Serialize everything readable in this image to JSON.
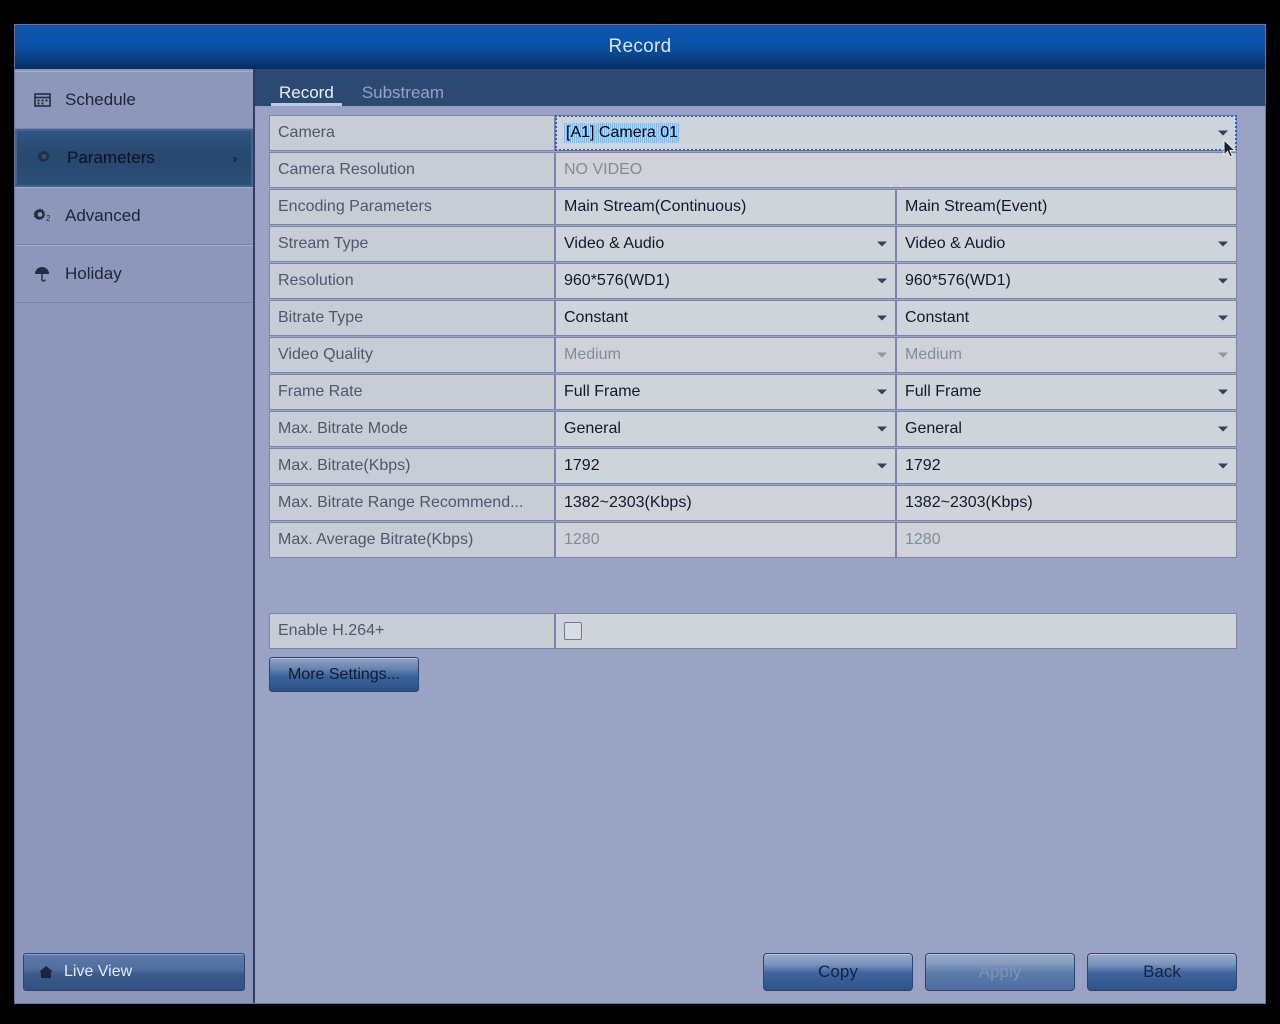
{
  "window": {
    "title": "Record"
  },
  "sidebar": {
    "items": [
      {
        "label": "Schedule",
        "icon": "calendar-icon",
        "active": false,
        "chevron": ""
      },
      {
        "label": "Parameters",
        "icon": "gear-icon",
        "active": true,
        "chevron": "›"
      },
      {
        "label": "Advanced",
        "icon": "gear-advanced-icon",
        "active": false,
        "chevron": ""
      },
      {
        "label": "Holiday",
        "icon": "umbrella-icon",
        "active": false,
        "chevron": ""
      }
    ],
    "live_view": {
      "label": "Live View",
      "icon": "home-icon"
    }
  },
  "tabs": [
    {
      "label": "Record",
      "active": true
    },
    {
      "label": "Substream",
      "active": false
    }
  ],
  "form": {
    "camera": {
      "label": "Camera",
      "value": "[A1] Camera 01",
      "selected": true
    },
    "camera_resolution": {
      "label": "Camera Resolution",
      "value": "NO VIDEO"
    },
    "columns": [
      "Main Stream(Continuous)",
      "Main Stream(Event)"
    ],
    "rows": [
      {
        "label": "Encoding Parameters",
        "type": "header",
        "left": "Main Stream(Continuous)",
        "right": "Main Stream(Event)",
        "disabled": false
      },
      {
        "label": "Stream Type",
        "type": "select",
        "left": "Video & Audio",
        "right": "Video & Audio",
        "disabled": false
      },
      {
        "label": "Resolution",
        "type": "select",
        "left": "960*576(WD1)",
        "right": "960*576(WD1)",
        "disabled": false
      },
      {
        "label": "Bitrate Type",
        "type": "select",
        "left": "Constant",
        "right": "Constant",
        "disabled": false
      },
      {
        "label": "Video Quality",
        "type": "select",
        "left": "Medium",
        "right": "Medium",
        "disabled": true
      },
      {
        "label": "Frame Rate",
        "type": "select",
        "left": "Full Frame",
        "right": "Full Frame",
        "disabled": false
      },
      {
        "label": "Max. Bitrate Mode",
        "type": "select",
        "left": "General",
        "right": "General",
        "disabled": false
      },
      {
        "label": "Max. Bitrate(Kbps)",
        "type": "select",
        "left": "1792",
        "right": "1792",
        "disabled": false
      },
      {
        "label": "Max. Bitrate Range Recommend...",
        "type": "text",
        "left": "1382~2303(Kbps)",
        "right": "1382~2303(Kbps)",
        "disabled": false
      },
      {
        "label": "Max. Average Bitrate(Kbps)",
        "type": "text",
        "left": "1280",
        "right": "1280",
        "disabled": true
      }
    ],
    "enable_h264plus": {
      "label": "Enable H.264+",
      "checked": false
    },
    "more_settings": {
      "label": "More Settings..."
    }
  },
  "footer": {
    "buttons": [
      {
        "label": "Copy",
        "disabled": false
      },
      {
        "label": "Apply",
        "disabled": true
      },
      {
        "label": "Back",
        "disabled": false
      }
    ]
  },
  "colors": {
    "titlebar_blue": "#0a54ab",
    "window_bg": "#9aa3c4",
    "sidebar_bg": "#8d97ba",
    "active_item": "#2c5076",
    "tabbar_bg": "#2c4a71",
    "cell_bg": "#cfd3da",
    "label_bg": "#c8ccd4",
    "selection_blue": "#8fc2f0"
  }
}
